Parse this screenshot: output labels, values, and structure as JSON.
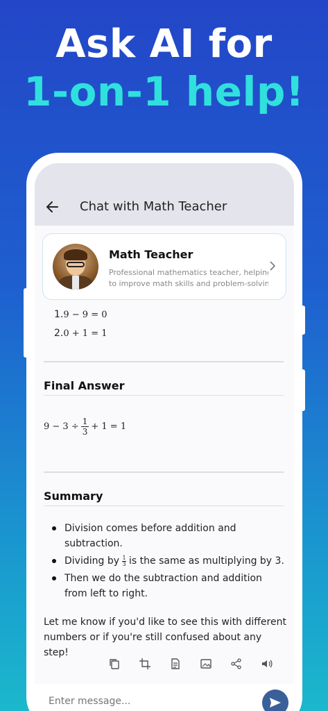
{
  "headline": {
    "line1": "Ask AI for",
    "line2": "1-on-1 help!"
  },
  "appbar": {
    "title": "Chat with Math Teacher"
  },
  "profile": {
    "name": "Math Teacher",
    "desc_line1": "Professional mathematics teacher, helping",
    "desc_line2": "to improve math skills and problem-solving..."
  },
  "steps": [
    {
      "num": "1.",
      "expr": "9 − 9 = 0"
    },
    {
      "num": "2.",
      "expr": "0 + 1 = 1"
    }
  ],
  "final_answer": {
    "heading": "Final Answer",
    "eq_left": "9 − 3 ÷",
    "frac_num": "1",
    "frac_den": "3",
    "eq_right": "+ 1 = 1"
  },
  "summary": {
    "heading": "Summary",
    "bullet1": "Division comes before addition and subtraction.",
    "bullet2_pre": "Dividing by",
    "bullet2_frac_num": "1",
    "bullet2_frac_den": "3",
    "bullet2_post": "is the same as multiplying by 3.",
    "bullet3": "Then we do the subtraction and addition from left to right."
  },
  "closing": "Let me know if you'd like to see this with different numbers or if you're still confused about any step!",
  "actions": [
    "copy-icon",
    "crop-icon",
    "document-icon",
    "image-icon",
    "share-icon",
    "speaker-icon"
  ],
  "composer": {
    "placeholder": "Enter message..."
  }
}
